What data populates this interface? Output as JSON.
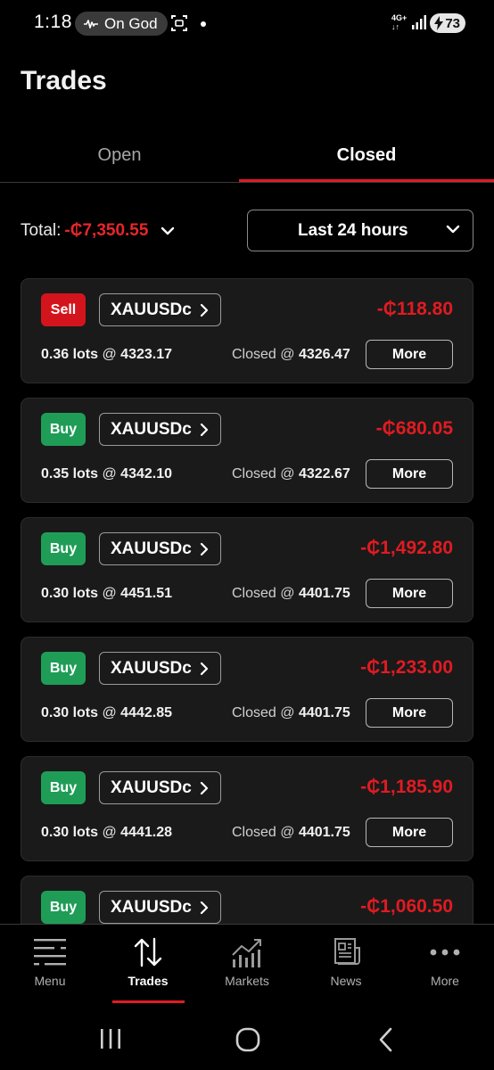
{
  "status_bar": {
    "time": "1:18",
    "pill_text": "On God",
    "network": "4G+",
    "battery": "73"
  },
  "header": {
    "title": "Trades"
  },
  "tabs": [
    {
      "label": "Open",
      "active": false
    },
    {
      "label": "Closed",
      "active": true
    }
  ],
  "summary": {
    "total_label": "Total:",
    "total_value": "-₵7,350.55",
    "period": "Last 24 hours"
  },
  "trades": [
    {
      "side": "Sell",
      "symbol": "XAUUSDc",
      "pnl": "-₵118.80",
      "lots": "0.36 lots",
      "open_price": "4323.17",
      "closed_label": "Closed @",
      "close_price": "4326.47",
      "more_label": "More"
    },
    {
      "side": "Buy",
      "symbol": "XAUUSDc",
      "pnl": "-₵680.05",
      "lots": "0.35 lots",
      "open_price": "4342.10",
      "closed_label": "Closed @",
      "close_price": "4322.67",
      "more_label": "More"
    },
    {
      "side": "Buy",
      "symbol": "XAUUSDc",
      "pnl": "-₵1,492.80",
      "lots": "0.30 lots",
      "open_price": "4451.51",
      "closed_label": "Closed @",
      "close_price": "4401.75",
      "more_label": "More"
    },
    {
      "side": "Buy",
      "symbol": "XAUUSDc",
      "pnl": "-₵1,233.00",
      "lots": "0.30 lots",
      "open_price": "4442.85",
      "closed_label": "Closed @",
      "close_price": "4401.75",
      "more_label": "More"
    },
    {
      "side": "Buy",
      "symbol": "XAUUSDc",
      "pnl": "-₵1,185.90",
      "lots": "0.30 lots",
      "open_price": "4441.28",
      "closed_label": "Closed @",
      "close_price": "4401.75",
      "more_label": "More"
    },
    {
      "side": "Buy",
      "symbol": "XAUUSDc",
      "pnl": "-₵1,060.50",
      "lots": "",
      "open_price": "",
      "closed_label": "",
      "close_price": "",
      "more_label": ""
    }
  ],
  "bottom_nav": [
    {
      "label": "Menu",
      "icon": "menu-icon",
      "active": false
    },
    {
      "label": "Trades",
      "icon": "trades-icon",
      "active": true
    },
    {
      "label": "Markets",
      "icon": "markets-icon",
      "active": false
    },
    {
      "label": "News",
      "icon": "news-icon",
      "active": false
    },
    {
      "label": "More",
      "icon": "more-icon",
      "active": false
    }
  ],
  "colors": {
    "accent": "#e01b22",
    "sell": "#d4141c",
    "buy": "#1f9d57",
    "card_bg": "#1a1a1a",
    "loss": "#e01b22"
  }
}
